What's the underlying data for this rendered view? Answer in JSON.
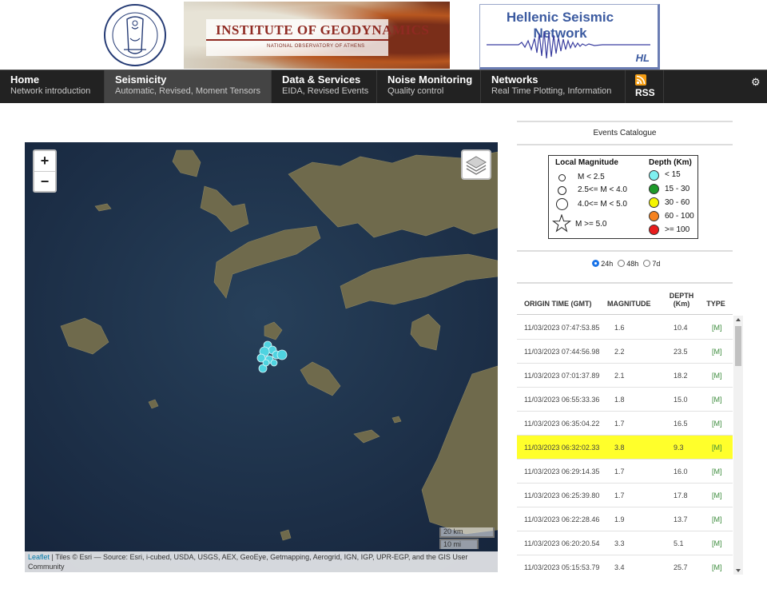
{
  "header": {
    "institute_title": "INSTITUTE OF GEODYNAMICS",
    "institute_subtitle": "NATIONAL OBSERVATORY OF ATHENS",
    "network_title": "Hellenic Seismic Network",
    "network_code": "HL"
  },
  "nav": {
    "items": [
      {
        "title": "Home",
        "subtitle": "Network introduction"
      },
      {
        "title": "Seismicity",
        "subtitle": "Automatic, Revised, Moment Tensors"
      },
      {
        "title": "Data & Services",
        "subtitle": "EIDA, Revised Events"
      },
      {
        "title": "Noise Monitoring",
        "subtitle": "Quality control"
      },
      {
        "title": "Networks",
        "subtitle": "Real Time Plotting, Information"
      }
    ],
    "rss_label": "RSS",
    "active_index": 1
  },
  "map": {
    "zoom_in": "+",
    "zoom_out": "−",
    "scale_km": "20 km",
    "scale_mi": "10 mi",
    "attribution_link": "Leaflet",
    "attribution_text": " | Tiles © Esri — Source: Esri, i-cubed, USDA, USGS, AEX, GeoEye, Getmapping, Aerogrid, IGN, IGP, UPR-EGP, and the GIS User Community",
    "event_color": "#4fd3e0"
  },
  "catalogue": {
    "title": "Events Catalogue",
    "legend": {
      "magnitude_header": "Local Magnitude",
      "magnitude_classes": [
        "M < 2.5",
        "2.5<= M < 4.0",
        "4.0<= M < 5.0",
        "M >= 5.0"
      ],
      "depth_header": "Depth (Km)",
      "depth_classes": [
        {
          "label": "< 15",
          "color": "#7ff0f0"
        },
        {
          "label": "15 - 30",
          "color": "#1e9a2a"
        },
        {
          "label": "30 - 60",
          "color": "#f5f500"
        },
        {
          "label": "60 - 100",
          "color": "#f5821f"
        },
        {
          "label": ">= 100",
          "color": "#e81c1c"
        }
      ]
    },
    "periods": [
      "24h",
      "48h",
      "7d"
    ],
    "selected_period": "24h",
    "columns": [
      "ORIGIN TIME (GMT)",
      "MAGNITUDE",
      "DEPTH (Km)",
      "TYPE"
    ],
    "events": [
      {
        "time": "11/03/2023 07:47:53.85",
        "mag": "1.6",
        "depth": "10.4",
        "type": "[M]"
      },
      {
        "time": "11/03/2023 07:44:56.98",
        "mag": "2.2",
        "depth": "23.5",
        "type": "[M]"
      },
      {
        "time": "11/03/2023 07:01:37.89",
        "mag": "2.1",
        "depth": "18.2",
        "type": "[M]"
      },
      {
        "time": "11/03/2023 06:55:33.36",
        "mag": "1.8",
        "depth": "15.0",
        "type": "[M]"
      },
      {
        "time": "11/03/2023 06:35:04.22",
        "mag": "1.7",
        "depth": "16.5",
        "type": "[M]"
      },
      {
        "time": "11/03/2023 06:32:02.33",
        "mag": "3.8",
        "depth": "9.3",
        "type": "[M]"
      },
      {
        "time": "11/03/2023 06:29:14.35",
        "mag": "1.7",
        "depth": "16.0",
        "type": "[M]"
      },
      {
        "time": "11/03/2023 06:25:39.80",
        "mag": "1.7",
        "depth": "17.8",
        "type": "[M]"
      },
      {
        "time": "11/03/2023 06:22:28.46",
        "mag": "1.9",
        "depth": "13.7",
        "type": "[M]"
      },
      {
        "time": "11/03/2023 06:20:20.54",
        "mag": "3.3",
        "depth": "5.1",
        "type": "[M]"
      },
      {
        "time": "11/03/2023 05:15:53.79",
        "mag": "3.4",
        "depth": "25.7",
        "type": "[M]"
      }
    ],
    "highlight_color": "#ffff2b"
  }
}
